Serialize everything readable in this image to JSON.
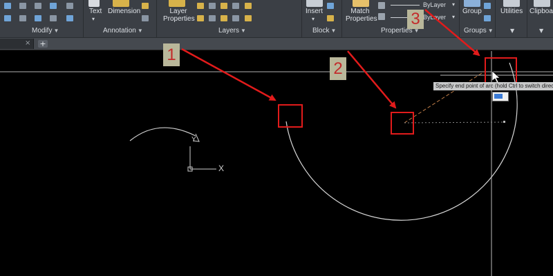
{
  "ribbon": {
    "modify": {
      "label": "Modify"
    },
    "annotation": {
      "label": "Annotation",
      "text_label": "Text",
      "dimension_label": "Dimension"
    },
    "layers": {
      "label": "Layers",
      "layer_properties_label": "Layer Properties"
    },
    "block": {
      "label": "Block",
      "insert_label": "Insert"
    },
    "properties": {
      "label": "Properties",
      "match_properties_label": "Match Properties",
      "linetype_value": "ByLayer",
      "lineweight_value": "ByLayer"
    },
    "groups": {
      "label": "Groups",
      "group_label": "Group"
    },
    "utilities": {
      "label": "Utilities"
    },
    "clipboard": {
      "label": "Clipboard"
    }
  },
  "canvas": {
    "tooltip_text": "Specify end point of arc (hold Ctrl to switch direction):",
    "ucs": {
      "x_label": "X",
      "y_label": "Y"
    }
  },
  "annotations": {
    "callout_1": "1",
    "callout_2": "2",
    "callout_3": "3"
  },
  "colors": {
    "ribbon_bg": "#3b3f45",
    "canvas_bg": "#000000",
    "callout_red": "#e21b1b",
    "callout_label_bg": "#b9b79a"
  }
}
